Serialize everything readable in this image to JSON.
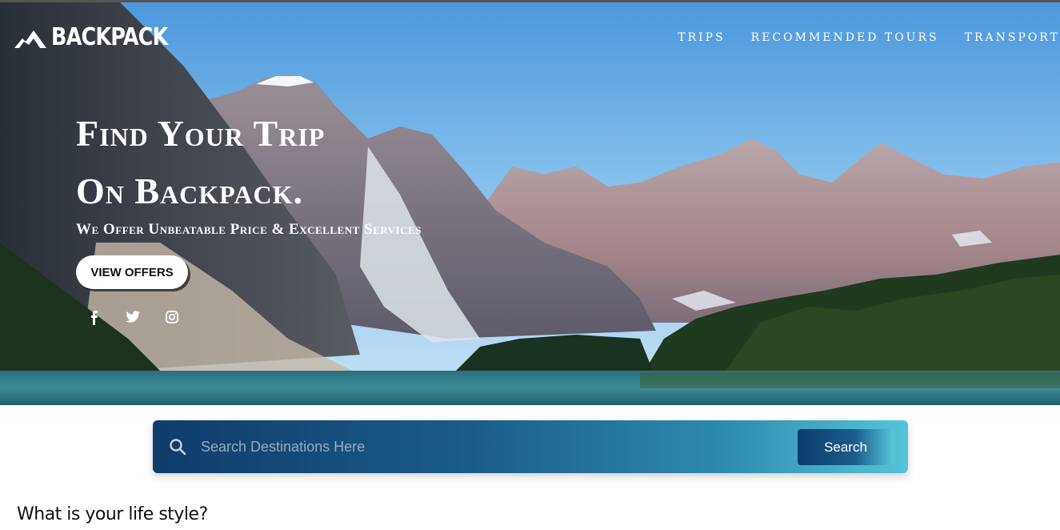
{
  "brand": {
    "name": "BACKPACK"
  },
  "nav": {
    "items": [
      {
        "label": "TRIPS"
      },
      {
        "label": "RECOMMENDED TOURS"
      },
      {
        "label": "TRANSPORT"
      }
    ]
  },
  "hero": {
    "title_line1": "Find Your Trip",
    "title_line2": "On Backpack.",
    "subtitle": "We Offer Unbeatable Price & Excellent Services",
    "cta_label": "VIEW OFFERS",
    "social": [
      "facebook-icon",
      "twitter-icon",
      "instagram-icon"
    ]
  },
  "search": {
    "placeholder": "Search Destinations Here",
    "button_label": "Search"
  },
  "section": {
    "title": "What is your life style?"
  },
  "colors": {
    "search_dark": "#0f3c6b",
    "search_light": "#55c4d9",
    "sky": "#6fb3ea"
  }
}
